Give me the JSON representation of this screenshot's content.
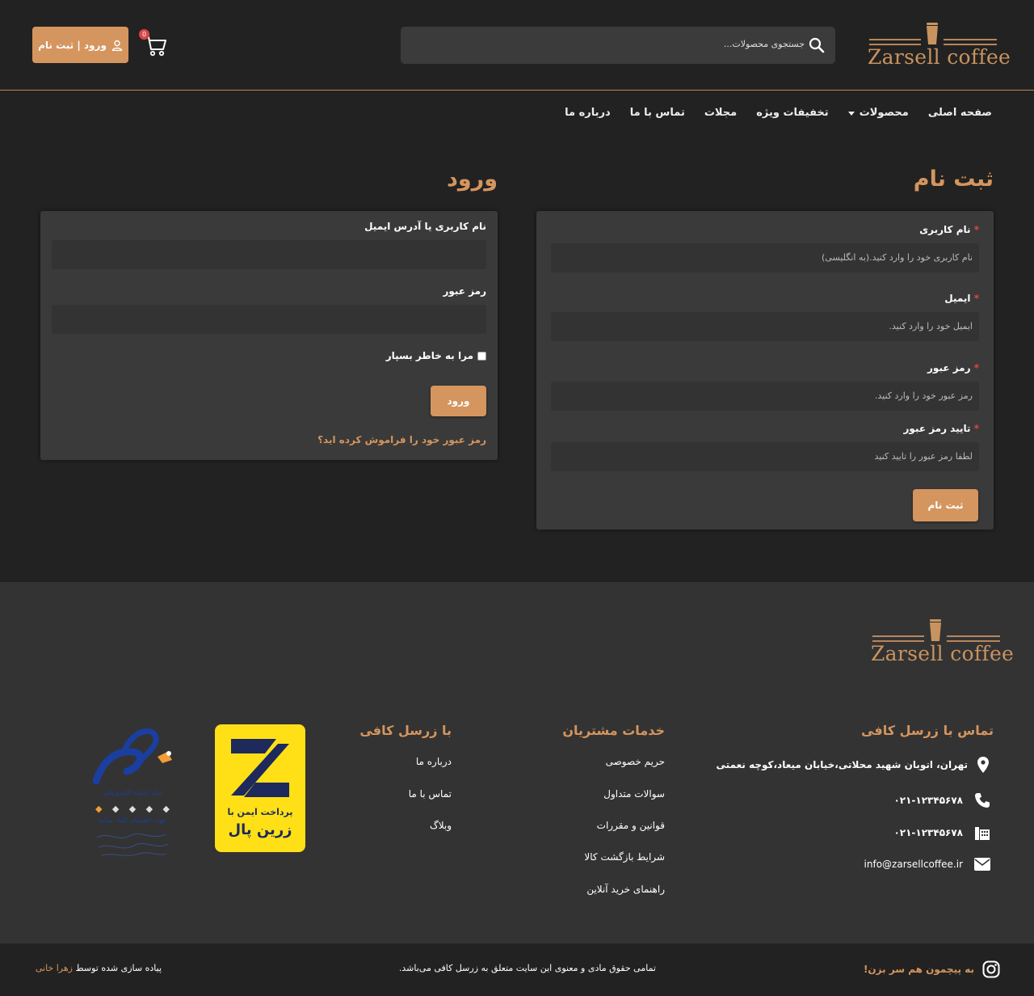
{
  "brand": {
    "name": "Zarsell coffee"
  },
  "header": {
    "search_placeholder": "جستجوی محصولات...",
    "cart_count": "0",
    "auth_button": "ورود | ثبت نام"
  },
  "nav": {
    "items": [
      {
        "label": "صفحه اصلی",
        "dropdown": false
      },
      {
        "label": "محصولات",
        "dropdown": true
      },
      {
        "label": "تخفیفات ویژه",
        "dropdown": false
      },
      {
        "label": "مجلات",
        "dropdown": false
      },
      {
        "label": "تماس با ما",
        "dropdown": false
      },
      {
        "label": "درباره ما",
        "dropdown": false
      }
    ]
  },
  "register": {
    "title": "ثبت نام",
    "fields": [
      {
        "label": "نام کاربری",
        "required": "*",
        "placeholder": "نام کاربری خود را وارد کنید.(به انگلیسی)"
      },
      {
        "label": "ایمیل",
        "required": "*",
        "placeholder": "ایمیل خود را وارد کنید."
      },
      {
        "label": "رمز عبور",
        "required": "*",
        "placeholder": "رمز عبور خود را وارد کنید."
      },
      {
        "label": "تایید رمز عبور",
        "required": "*",
        "placeholder": "لطفا رمز عبور را تایید کنید"
      }
    ],
    "submit": "ثبت نام"
  },
  "login": {
    "title": "ورود",
    "username_label": "نام کاربری یا آدرس ایمیل",
    "password_label": "رمز عبور",
    "remember_label": "مرا به خاطر بسپار",
    "submit": "ورود",
    "forgot": "رمز عبور خود را فراموش کرده اید؟"
  },
  "footer": {
    "contact": {
      "title": "تماس با زرسل کافی",
      "address": "تهران، اتوبان شهید محلاتی،خیابان میعاد،کوچه نعمتی",
      "phone": "۰۲۱-۱۲۳۴۵۶۷۸",
      "fax": "۰۲۱-۱۲۳۴۵۶۷۸",
      "email": "info@zarsellcoffee.ir"
    },
    "services": {
      "title": "خدمات مشتریان",
      "links": [
        "حریم خصوصی",
        "سوالات متداول",
        "قوانین و مقررات",
        "شرایط بازگشت کالا",
        "راهنمای خرید آنلاین"
      ]
    },
    "about": {
      "title": "با زرسل کافی",
      "links": [
        "درباره ما",
        "تماس با ما",
        "وبلاگ"
      ]
    },
    "zarinpal": {
      "line1": "پرداخت ایمن با",
      "line2": "زرین پال"
    },
    "enamad": {
      "line1": "نماد اعتماد الکترونیکی",
      "line2": "جهت اطمینان کلیک نمایید"
    }
  },
  "bottom": {
    "instagram": "به پیچمون هم سر بزن!",
    "copyright": "تمامی حقوق مادی و معنوی این سایت متعلق به زرسل کافی می‌باشد.",
    "credit_prefix": "پیاده سازی شده توسط",
    "credit_name": "زهرا خانی"
  },
  "colors": {
    "accent": "#d5955e",
    "bg": "#222222",
    "card": "#3a3a3a",
    "footer": "#333333",
    "required": "#e0453f"
  }
}
